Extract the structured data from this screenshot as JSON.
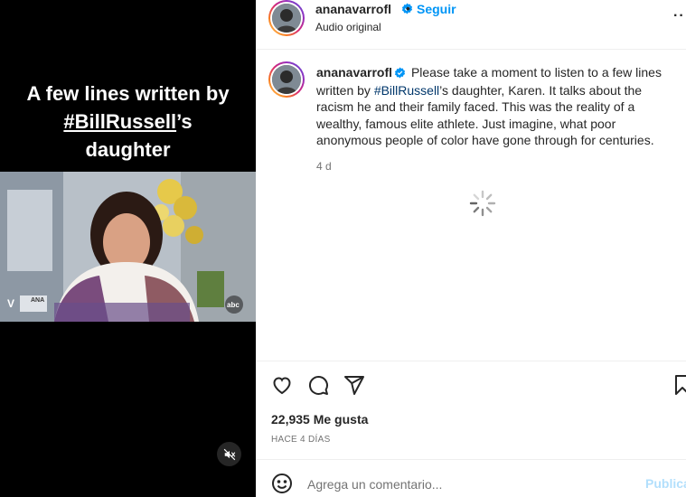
{
  "video": {
    "caption_line1": "A few lines written by",
    "caption_hashtag": "#BillRussell",
    "caption_suffix": "’s",
    "caption_line3": "daughter",
    "lower_third": "ANA",
    "network_logo": "abc"
  },
  "header": {
    "username": "ananavarrofl",
    "separator": "•",
    "follow_label": "Seguir",
    "audio_label": "Audio original",
    "more_label": "··"
  },
  "caption": {
    "username": "ananavarrofl",
    "text_part1": "Please take a moment to listen to a few lines written by ",
    "hashtag": "#BillRussell",
    "text_part2": "’s daughter, Karen. It talks about the racism he and their family faced. This was the reality of a wealthy, famous elite athlete. Just imagine, what poor anonymous people of color have gone through for centuries.",
    "time_ago": "4 d"
  },
  "stats": {
    "likes": "22,935 Me gusta",
    "date": "HACE 4 DÍAS"
  },
  "comment": {
    "placeholder": "Agrega un comentario...",
    "publish_label": "Publicar"
  },
  "colors": {
    "accent": "#0095f6",
    "hashtag": "#00376b",
    "publish_disabled": "#b2dffc",
    "video_bg": "#000000"
  },
  "icons": [
    "mute-icon",
    "verified-icon",
    "heart-icon",
    "comment-icon",
    "share-icon",
    "bookmark-icon",
    "emoji-icon",
    "loading-spinner-icon"
  ]
}
